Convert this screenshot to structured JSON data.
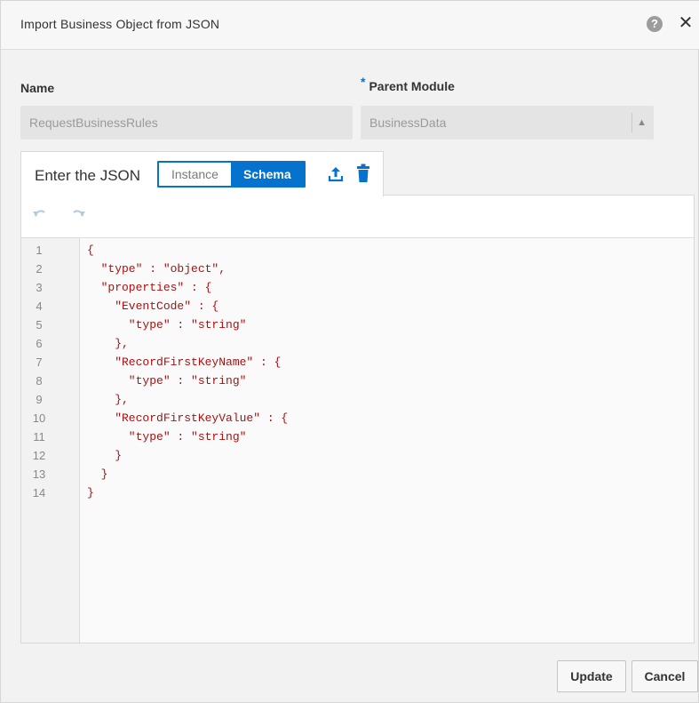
{
  "dialog": {
    "title": "Import Business Object from JSON",
    "help_icon": "?",
    "close_icon": "✕"
  },
  "form": {
    "name_label": "Name",
    "name_value": "RequestBusinessRules",
    "parent_label": "Parent Module",
    "parent_required": "*",
    "parent_value": "BusinessData"
  },
  "json_editor": {
    "tab_label": "Enter the JSON",
    "modes": [
      "Instance",
      "Schema"
    ],
    "active_mode": "Schema",
    "icons": [
      "upload-icon",
      "trash-icon",
      "undo-icon",
      "redo-icon"
    ],
    "line_numbers": [
      "1",
      "2",
      "3",
      "4",
      "5",
      "6",
      "7",
      "8",
      "9",
      "10",
      "11",
      "12",
      "13",
      "14"
    ],
    "lines": [
      "{",
      "  \"type\" : \"object\",",
      "  \"properties\" : {",
      "    \"EventCode\" : {",
      "      \"type\" : \"string\"",
      "    },",
      "    \"RecordFirstKeyName\" : {",
      "      \"type\" : \"string\"",
      "    },",
      "    \"RecordFirstKeyValue\" : {",
      "      \"type\" : \"string\"",
      "    }",
      "  }",
      "}"
    ]
  },
  "footer": {
    "update_label": "Update",
    "cancel_label": "Cancel"
  },
  "colors": {
    "accent": "#0572ce",
    "code_string": "#aa1111",
    "dialog_bg": "#f2f2f2"
  }
}
